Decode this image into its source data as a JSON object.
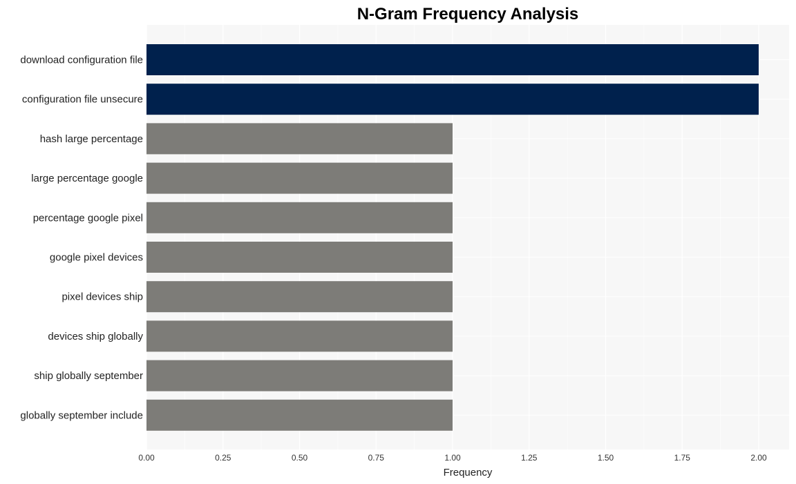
{
  "chart_data": {
    "type": "bar",
    "orientation": "horizontal",
    "title": "N-Gram Frequency Analysis",
    "xlabel": "Frequency",
    "ylabel": "",
    "xlim": [
      0,
      2.1
    ],
    "xticks": [
      "0.00",
      "0.25",
      "0.50",
      "0.75",
      "1.00",
      "1.25",
      "1.50",
      "1.75",
      "2.00"
    ],
    "xtick_values": [
      0,
      0.25,
      0.5,
      0.75,
      1.0,
      1.25,
      1.5,
      1.75,
      2.0
    ],
    "grid": true,
    "categories": [
      "download configuration file",
      "configuration file unsecure",
      "hash large percentage",
      "large percentage google",
      "percentage google pixel",
      "google pixel devices",
      "pixel devices ship",
      "devices ship globally",
      "ship globally september",
      "globally september include"
    ],
    "values": [
      2,
      2,
      1,
      1,
      1,
      1,
      1,
      1,
      1,
      1
    ],
    "colors": {
      "highlight": "#00214d",
      "default": "#7d7c78",
      "panel_background": "#f7f7f7",
      "grid": "#ffffff"
    }
  }
}
